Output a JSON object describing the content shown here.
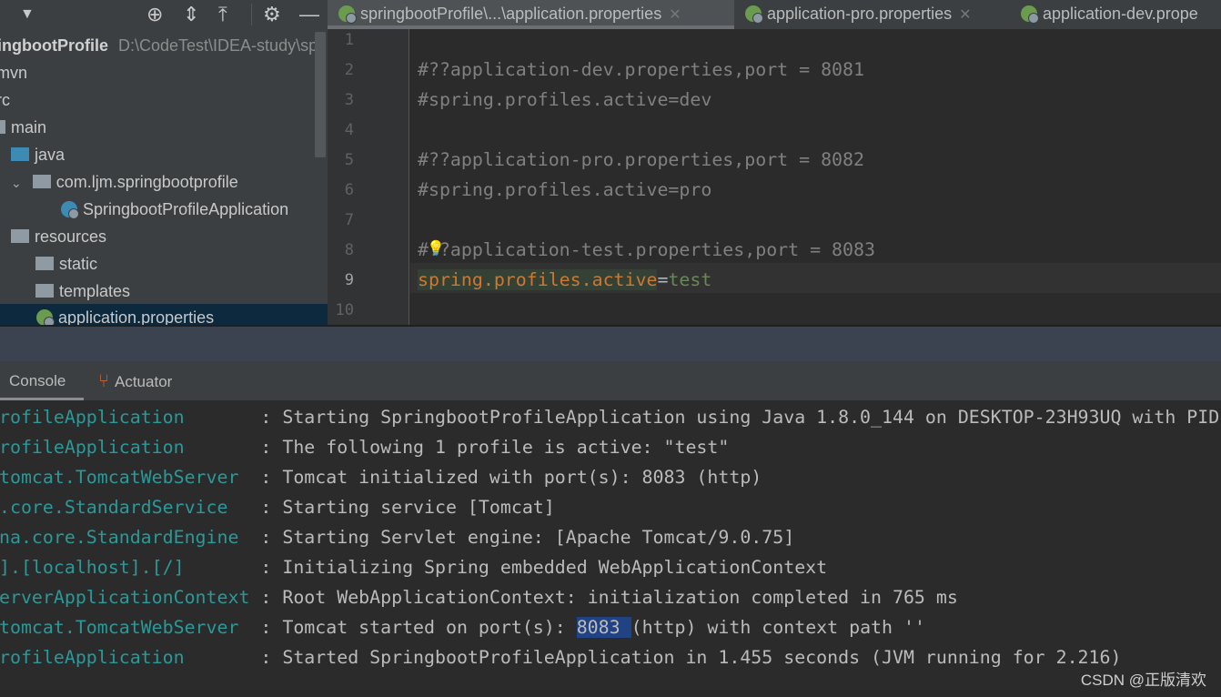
{
  "project_panel": {
    "toolbar_icons": [
      "dropdown-icon",
      "locate-icon",
      "expand-all-icon",
      "collapse-all-icon",
      "gear-icon",
      "minimize-icon"
    ],
    "root": {
      "name": "ingbootProfile",
      "path": "D:\\CodeTest\\IDEA-study\\sp"
    },
    "items": [
      {
        "label": "mvn",
        "icon": "folder"
      },
      {
        "label": "rc",
        "icon": "folder"
      },
      {
        "label": "main",
        "icon": "folder"
      },
      {
        "label": "java",
        "icon": "source-folder"
      },
      {
        "label": "com.ljm.springbootprofile",
        "icon": "package"
      },
      {
        "label": "SpringbootProfileApplication",
        "icon": "spring-boot-app"
      },
      {
        "label": "resources",
        "icon": "resources-folder"
      },
      {
        "label": "static",
        "icon": "folder"
      },
      {
        "label": "templates",
        "icon": "folder"
      },
      {
        "label": "application.properties",
        "icon": "spring-properties",
        "selected": true
      }
    ]
  },
  "editor": {
    "tabs": [
      {
        "label": "springbootProfile\\...\\application.properties",
        "active": true
      },
      {
        "label": "application-pro.properties",
        "active": false
      },
      {
        "label": "application-dev.prope",
        "active": false
      }
    ],
    "current_line": 9,
    "lines": [
      "",
      "#??application-dev.properties,port = 8081",
      "#spring.profiles.active=dev",
      "",
      "#??application-pro.properties,port = 8082",
      "#spring.profiles.active=pro",
      "",
      "#??application-test.properties,port = 8083",
      {
        "key": "spring.profiles.active",
        "eq": "=",
        "value": "test"
      },
      ""
    ]
  },
  "run_panel": {
    "tabs": [
      {
        "label": "Console",
        "active": true
      },
      {
        "label": "Actuator",
        "icon": "actuator-icon"
      }
    ],
    "log": [
      {
        "logger": "rofileApplication",
        "msg": "Starting SpringbootProfileApplication using Java 1.8.0_144 on DESKTOP-23H93UQ with PID"
      },
      {
        "logger": "rofileApplication",
        "msg": "The following 1 profile is active: \"test\""
      },
      {
        "logger": "tomcat.TomcatWebServer",
        "msg": "Tomcat initialized with port(s): 8083 (http)"
      },
      {
        "logger": ".core.StandardService",
        "msg": "Starting service [Tomcat]"
      },
      {
        "logger": "na.core.StandardEngine",
        "msg": "Starting Servlet engine: [Apache Tomcat/9.0.75]"
      },
      {
        "logger": "].[localhost].[/]",
        "msg": "Initializing Spring embedded WebApplicationContext"
      },
      {
        "logger": "erverApplicationContext",
        "msg": "Root WebApplicationContext: initialization completed in 765 ms"
      },
      {
        "logger": "tomcat.TomcatWebServer",
        "msg_pre": "Tomcat started on port(s): ",
        "msg_hl": "8083 ",
        "msg_post": "(http) with context path ''"
      },
      {
        "logger": "rofileApplication",
        "msg": "Started SpringbootProfileApplication in 1.455 seconds (JVM running for 2.216)"
      }
    ]
  },
  "watermark": "CSDN @正版清欢",
  "colors": {
    "logger": "#299999",
    "key": "#cc7832",
    "value": "#6a8759",
    "selection": "#214283"
  }
}
